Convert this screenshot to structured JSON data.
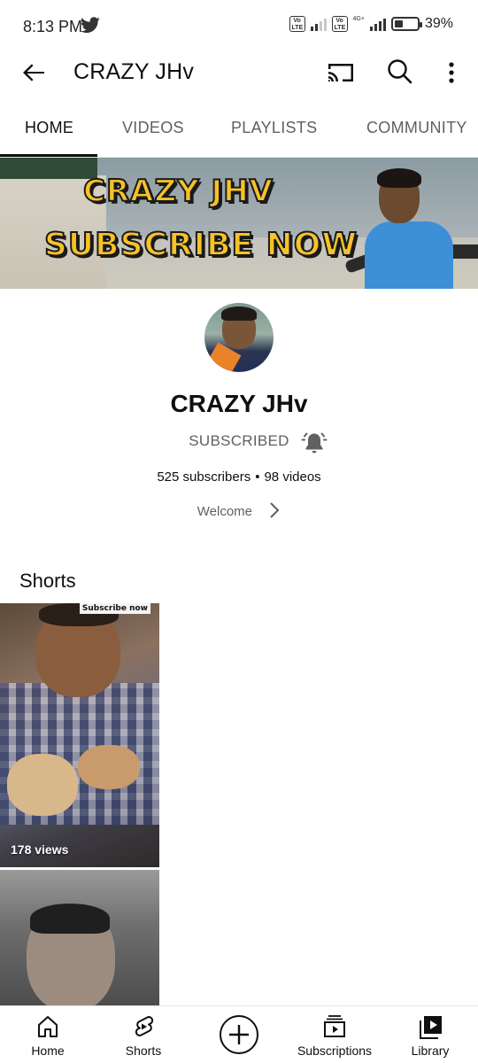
{
  "status_bar": {
    "time": "8:13 PM",
    "network_type": "4G+",
    "lte1": "Vo LTE",
    "lte2": "Vo LTE",
    "battery_level": 0.39,
    "battery_text": "39%"
  },
  "app_bar": {
    "title": "CRAZY JHv"
  },
  "tabs": [
    {
      "label": "HOME",
      "active": true
    },
    {
      "label": "VIDEOS",
      "active": false
    },
    {
      "label": "PLAYLISTS",
      "active": false
    },
    {
      "label": "COMMUNITY",
      "active": false
    }
  ],
  "banner": {
    "line1": "CRAZY JHV",
    "line2": "SUBSCRIBE NOW"
  },
  "channel": {
    "name": "CRAZY JHv",
    "subscribe_state": "SUBSCRIBED",
    "subscribers": "525 subscribers",
    "videos": "98 videos",
    "separator": "•",
    "description": "Welcome"
  },
  "shorts": {
    "heading": "Shorts",
    "items": [
      {
        "overlay_tag": "Subscribe now",
        "views": "178 views"
      },
      {
        "overlay_tag": "",
        "views": ""
      }
    ]
  },
  "bottom_nav": [
    {
      "label": "Home",
      "icon": "home-icon"
    },
    {
      "label": "Shorts",
      "icon": "shorts-icon"
    },
    {
      "label": "",
      "icon": "create-plus-icon"
    },
    {
      "label": "Subscriptions",
      "icon": "subscriptions-icon"
    },
    {
      "label": "Library",
      "icon": "library-icon"
    }
  ],
  "colors": {
    "banner_text": "#f6c229",
    "active_tab": "#0f0f0f",
    "inactive_tab": "#606060"
  }
}
